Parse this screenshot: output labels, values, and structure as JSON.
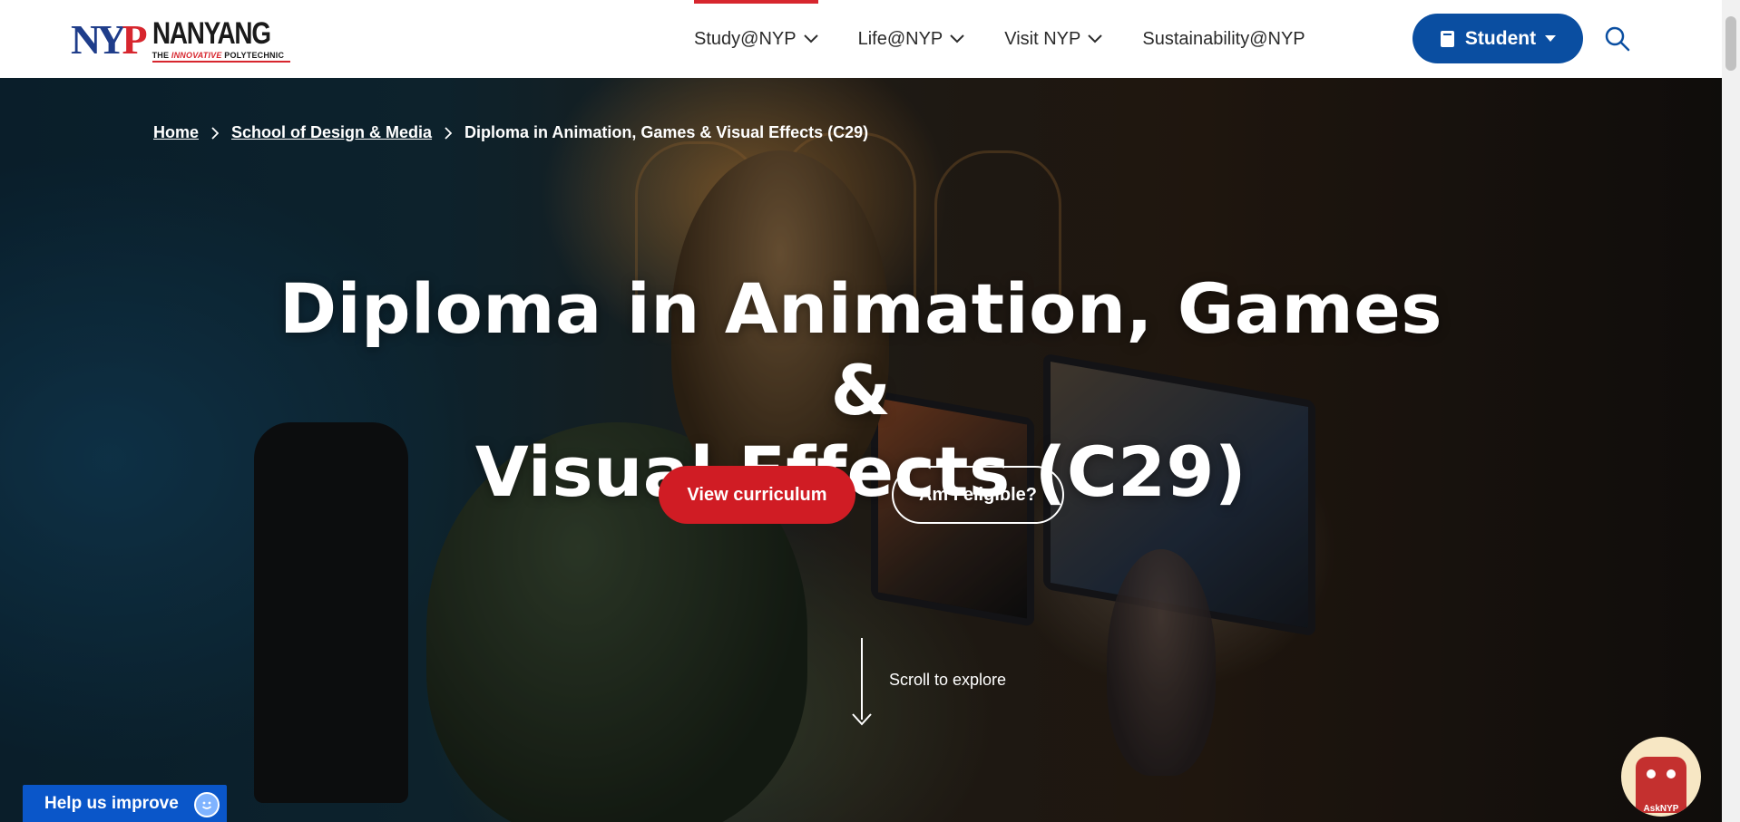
{
  "header": {
    "logo": {
      "mark": "NYP",
      "name": "NANYANG",
      "tagline_prefix": "THE",
      "tagline_highlight": "INNOVATIVE",
      "tagline_suffix": "POLYTECHNIC"
    },
    "nav": [
      {
        "label": "Study@NYP",
        "has_dropdown": true,
        "active": true
      },
      {
        "label": "Life@NYP",
        "has_dropdown": true,
        "active": false
      },
      {
        "label": "Visit NYP",
        "has_dropdown": true,
        "active": false
      },
      {
        "label": "Sustainability@NYP",
        "has_dropdown": false,
        "active": false
      }
    ],
    "student_button": "Student",
    "icons": {
      "student": "book-icon",
      "search": "search-icon"
    }
  },
  "breadcrumb": {
    "home": "Home",
    "school": "School of Design & Media",
    "current": "Diploma in Animation, Games & Visual Effects (C29)"
  },
  "hero": {
    "title_line1": "Diploma in Animation, Games &",
    "title_line2": "Visual Effects (C29)",
    "primary_button": "View curriculum",
    "secondary_button": "Am I eligible?",
    "scroll_text": "Scroll to explore"
  },
  "widgets": {
    "help": "Help us improve",
    "chatbot": "AskNYP"
  },
  "colors": {
    "brand_blue": "#0a4ea1",
    "brand_red": "#d01c24",
    "logo_blue": "#1f3d8a",
    "help_blue": "#0a56c9"
  }
}
